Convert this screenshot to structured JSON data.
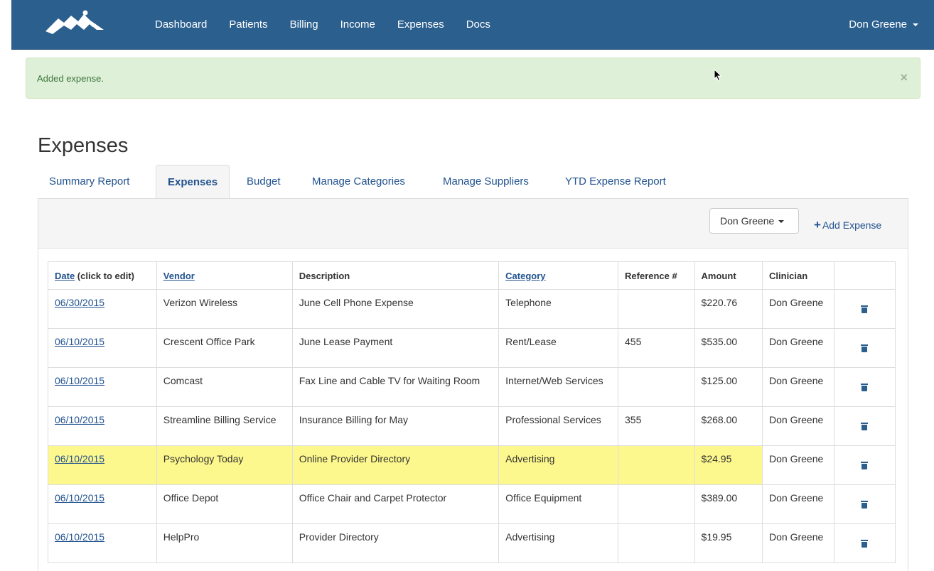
{
  "navbar": {
    "links": [
      "Dashboard",
      "Patients",
      "Billing",
      "Income",
      "Expenses",
      "Docs"
    ],
    "user": "Don Greene"
  },
  "alert": {
    "message": "Added expense.",
    "close": "×"
  },
  "page": {
    "title": "Expenses"
  },
  "tabs": [
    {
      "label": "Summary Report",
      "active": false
    },
    {
      "label": "Expenses",
      "active": true
    },
    {
      "label": "Budget",
      "active": false
    },
    {
      "label": "Manage Categories",
      "active": false
    },
    {
      "label": "Manage Suppliers",
      "active": false
    },
    {
      "label": "YTD Expense Report",
      "active": false
    }
  ],
  "toolbar": {
    "clinician_filter": "Don Greene",
    "add_label": "Add Expense",
    "add_symbol": "+"
  },
  "table": {
    "headers": {
      "date_link": "Date",
      "date_note": " (click to edit)",
      "vendor": "Vendor",
      "description": "Description",
      "category": "Category",
      "reference": "Reference #",
      "amount": "Amount",
      "clinician": "Clinician"
    },
    "rows": [
      {
        "date": "06/30/2015",
        "vendor": "Verizon Wireless",
        "description": "June Cell Phone Expense",
        "category": "Telephone",
        "reference": "",
        "amount": "$220.76",
        "clinician": "Don Greene"
      },
      {
        "date": "06/10/2015",
        "vendor": "Crescent Office Park",
        "description": "June Lease Payment",
        "category": "Rent/Lease",
        "reference": "455",
        "amount": "$535.00",
        "clinician": "Don Greene"
      },
      {
        "date": "06/10/2015",
        "vendor": "Comcast",
        "description": "Fax Line and Cable TV for Waiting Room",
        "category": "Internet/Web Services",
        "reference": "",
        "amount": "$125.00",
        "clinician": "Don Greene"
      },
      {
        "date": "06/10/2015",
        "vendor": "Streamline Billing Service",
        "description": "Insurance Billing for May",
        "category": "Professional Services",
        "reference": "355",
        "amount": "$268.00",
        "clinician": "Don Greene"
      },
      {
        "date": "06/10/2015",
        "vendor": "Psychology Today",
        "description": "Online Provider Directory",
        "category": "Advertising",
        "reference": "",
        "amount": "$24.95",
        "clinician": "Don Greene"
      },
      {
        "date": "06/10/2015",
        "vendor": "Office Depot",
        "description": "Office Chair and Carpet Protector",
        "category": "Office Equipment",
        "reference": "",
        "amount": "$389.00",
        "clinician": "Don Greene"
      },
      {
        "date": "06/10/2015",
        "vendor": "HelpPro",
        "description": "Provider Directory",
        "category": "Advertising",
        "reference": "",
        "amount": "$19.95",
        "clinician": "Don Greene"
      }
    ]
  },
  "colors": {
    "navbar": "#2b5f8e",
    "link": "#22538f",
    "alert_bg": "#dff0d8",
    "highlight": "#fdf88d"
  }
}
